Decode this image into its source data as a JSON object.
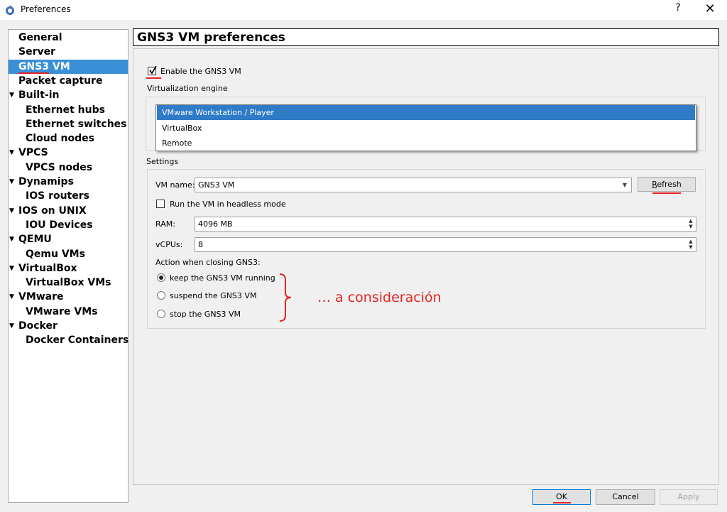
{
  "window": {
    "title": "Preferences",
    "help_label": "?",
    "close_label": "✕"
  },
  "sidebar": {
    "items": [
      {
        "label": "General",
        "level": 0
      },
      {
        "label": "Server",
        "level": 0
      },
      {
        "label": "GNS3 VM",
        "level": 0,
        "selected": true
      },
      {
        "label": "Packet capture",
        "level": 0
      },
      {
        "label": "Built-in",
        "level": 0,
        "expanded": true
      },
      {
        "label": "Ethernet hubs",
        "level": 1
      },
      {
        "label": "Ethernet switches",
        "level": 1
      },
      {
        "label": "Cloud nodes",
        "level": 1
      },
      {
        "label": "VPCS",
        "level": 0,
        "expanded": true
      },
      {
        "label": "VPCS nodes",
        "level": 1
      },
      {
        "label": "Dynamips",
        "level": 0,
        "expanded": true
      },
      {
        "label": "IOS routers",
        "level": 1
      },
      {
        "label": "IOS on UNIX",
        "level": 0,
        "expanded": true
      },
      {
        "label": "IOU Devices",
        "level": 1
      },
      {
        "label": "QEMU",
        "level": 0,
        "expanded": true
      },
      {
        "label": "Qemu VMs",
        "level": 1
      },
      {
        "label": "VirtualBox",
        "level": 0,
        "expanded": true
      },
      {
        "label": "VirtualBox VMs",
        "level": 1
      },
      {
        "label": "VMware",
        "level": 0,
        "expanded": true
      },
      {
        "label": "VMware VMs",
        "level": 1
      },
      {
        "label": "Docker",
        "level": 0,
        "expanded": true
      },
      {
        "label": "Docker Containers",
        "level": 1
      }
    ]
  },
  "page": {
    "title": "GNS3 VM preferences",
    "enable_label": "Enable the GNS3 VM",
    "enable_checked": true,
    "engine_label": "Virtualization engine",
    "engine_options": [
      "VMware Workstation / Player",
      "VirtualBox",
      "Remote"
    ],
    "engine_selected": "VMware Workstation / Player",
    "settings_label": "Settings",
    "vm_name_label": "VM name:",
    "vm_name_value": "GNS3 VM",
    "refresh_label": "Refresh",
    "headless_label": "Run the VM in headless mode",
    "headless_checked": false,
    "ram_label": "RAM:",
    "ram_value": "4096 MB",
    "vcpus_label": "vCPUs:",
    "vcpus_value": "8",
    "closing_label": "Action when closing GNS3:",
    "closing_options": [
      "keep the GNS3 VM running",
      "suspend the GNS3 VM",
      "stop the GNS3 VM"
    ],
    "closing_selected": "keep the GNS3 VM running"
  },
  "annotation": {
    "text": "… a consideración",
    "color": "#e52222"
  },
  "footer": {
    "ok_label": "OK",
    "cancel_label": "Cancel",
    "apply_label": "Apply"
  },
  "colors": {
    "selection": "#3a8fd7",
    "annotation": "#e52222"
  }
}
